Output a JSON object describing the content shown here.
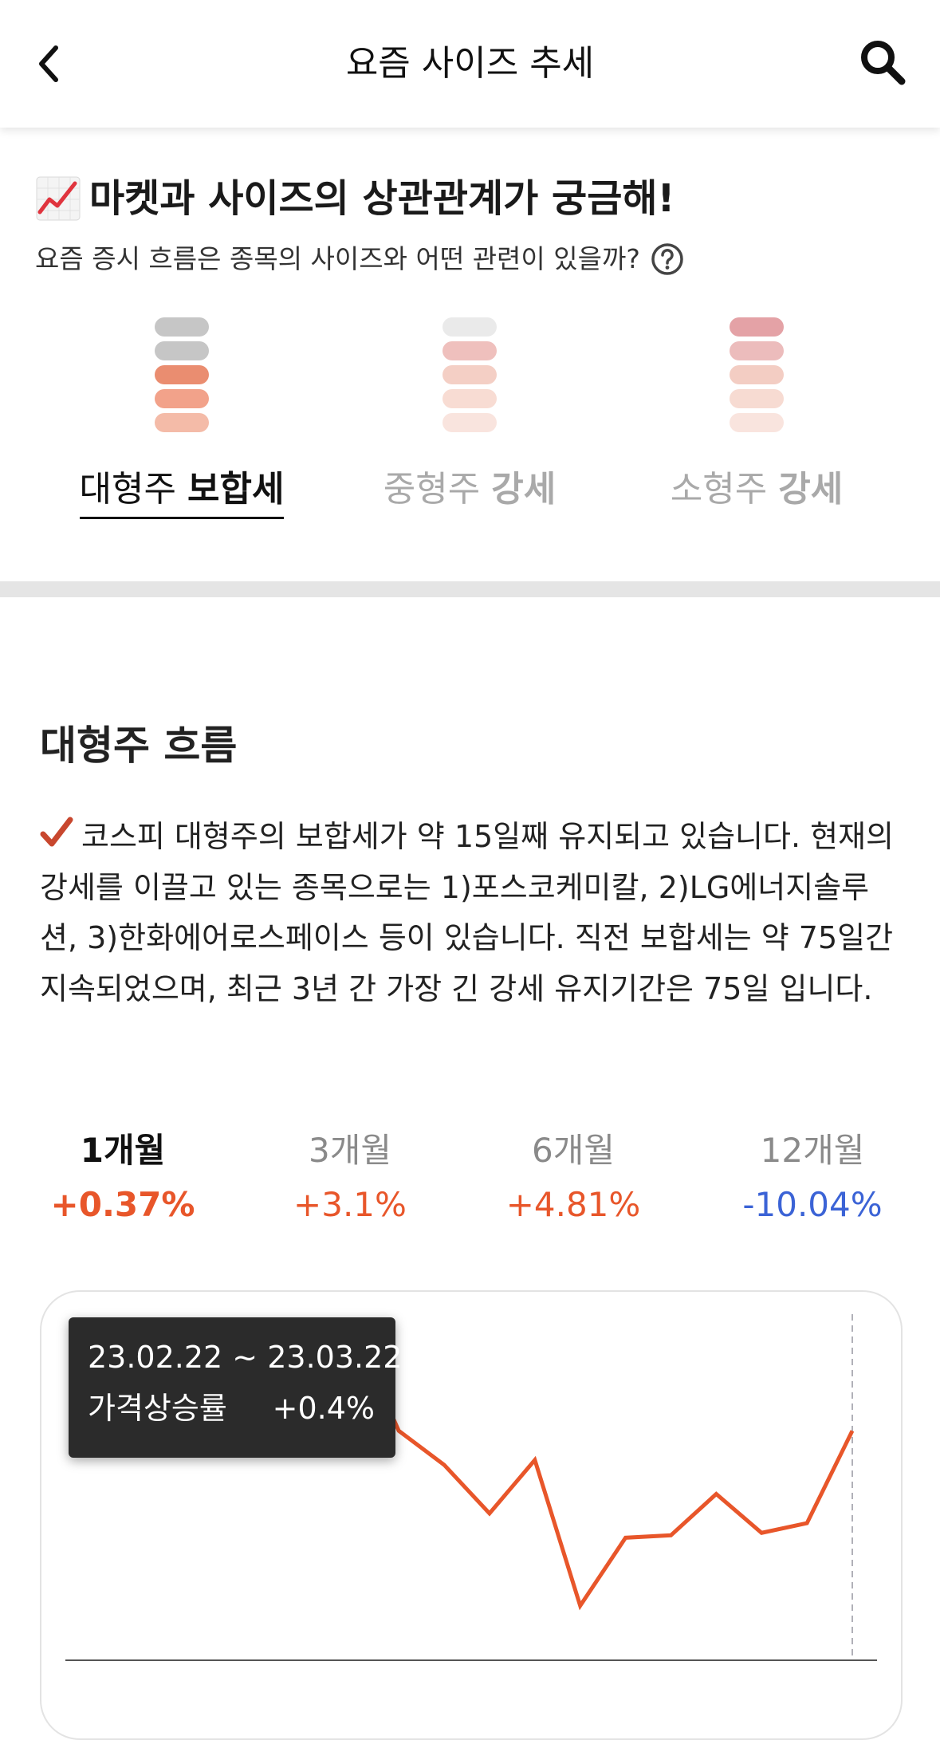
{
  "header": {
    "title": "요즘 사이즈 추세",
    "back_icon": "chevron-left-icon",
    "search_icon": "search-icon"
  },
  "section1": {
    "icon": "chart-increasing-icon",
    "title": "마켓과 사이즈의 상관관계가 궁금해!",
    "subtitle": "요즘 증시 흐름은 종목의 사이즈와 어떤 관련이 있을까?",
    "help_icon": "question-circle-icon"
  },
  "size_tabs": [
    {
      "name": "대형주",
      "trend": "보합세",
      "active": true,
      "pill_colors": [
        "#c6c6c6",
        "#c6c6c6",
        "#ea8d70",
        "#f2a28a",
        "#f4bba8"
      ]
    },
    {
      "name": "중형주",
      "trend": "강세",
      "active": false,
      "pill_colors": [
        "#eaeaea",
        "#efc0bd",
        "#f4cfc5",
        "#f8dcd3",
        "#f9e4de"
      ]
    },
    {
      "name": "소형주",
      "trend": "강세",
      "active": false,
      "pill_colors": [
        "#e4a2a6",
        "#ecbcbc",
        "#f3cdc3",
        "#f7dbd2",
        "#f9e4de"
      ]
    }
  ],
  "section2": {
    "title": "대형주 흐름",
    "description": "코스피 대형주의 보합세가 약 15일째 유지되고 있습니다. 현재의 강세를 이끌고 있는 종목으로는 1)포스코케미칼, 2)LG에너지솔루션, 3)한화에어로스페이스 등이 있습니다. 직전 보합세는 약 75일간 지속되었으며, 최근 3년 간 가장 긴 강세 유지기간은 75일 입니다.",
    "check_icon": "check-mark-icon"
  },
  "periods": [
    {
      "label": "1개월",
      "value": "+0.37%",
      "active": true,
      "color": "#e8562a"
    },
    {
      "label": "3개월",
      "value": "+3.1%",
      "active": false,
      "color": "#e8562a"
    },
    {
      "label": "6개월",
      "value": "+4.81%",
      "active": false,
      "color": "#e8562a"
    },
    {
      "label": "12개월",
      "value": "-10.04%",
      "active": false,
      "color": "#3b63d6"
    }
  ],
  "tooltip": {
    "range": "23.02.22 ~ 23.03.22",
    "metric_label": "가격상승률",
    "metric_value": "+0.4%"
  },
  "colors": {
    "line": "#e8562a",
    "up": "#e8562a",
    "down": "#3b63d6",
    "baseline": "#555555",
    "guide": "#b0b0b8"
  },
  "chart_data": {
    "type": "line",
    "note_hidden": "",
    "x": [
      1,
      2,
      3,
      4,
      5,
      6,
      7,
      8,
      9,
      10,
      11,
      12,
      13,
      14,
      15,
      16,
      17,
      18,
      19,
      20,
      21
    ],
    "values": [
      0.55,
      0.72,
      0.6,
      0.68,
      0.8,
      0.98,
      1.02,
      0.6,
      0.46,
      0.26,
      0.48,
      -0.12,
      0.16,
      0.17,
      0.34,
      0.18,
      0.22,
      0.6
    ],
    "title": "",
    "xlabel": "",
    "ylabel": "",
    "grid": false,
    "legend": "none"
  }
}
